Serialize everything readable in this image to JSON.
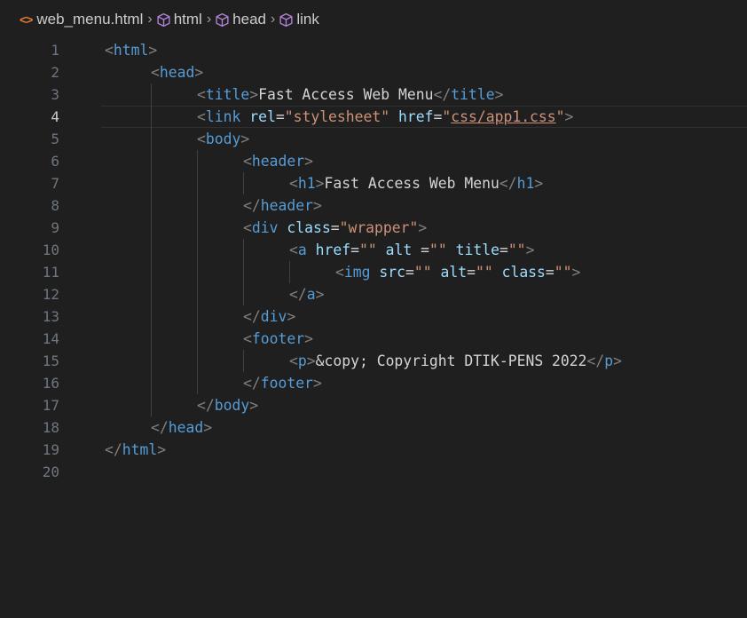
{
  "breadcrumb": {
    "file": "web_menu.html",
    "items": [
      "html",
      "head",
      "link"
    ]
  },
  "editor": {
    "current_line": 4,
    "lines": [
      {
        "n": "1",
        "indent": 0,
        "tokens": [
          [
            "t",
            "<"
          ],
          [
            "tag",
            "html"
          ],
          [
            "t",
            ">"
          ]
        ]
      },
      {
        "n": "2",
        "indent": 1,
        "tokens": [
          [
            "t",
            "<"
          ],
          [
            "tag",
            "head"
          ],
          [
            "t",
            ">"
          ]
        ]
      },
      {
        "n": "3",
        "indent": 2,
        "tokens": [
          [
            "t",
            "<"
          ],
          [
            "tag",
            "title"
          ],
          [
            "t",
            ">"
          ],
          [
            "txt",
            "Fast Access Web Menu"
          ],
          [
            "t",
            "</"
          ],
          [
            "tag",
            "title"
          ],
          [
            "t",
            ">"
          ]
        ]
      },
      {
        "n": "4",
        "indent": 2,
        "tokens": [
          [
            "t",
            "<"
          ],
          [
            "tag",
            "link"
          ],
          [
            "txt",
            " "
          ],
          [
            "attr",
            "rel"
          ],
          [
            "txt",
            "="
          ],
          [
            "str",
            "\"stylesheet\""
          ],
          [
            "txt",
            " "
          ],
          [
            "attr",
            "href"
          ],
          [
            "txt",
            "="
          ],
          [
            "str",
            "\""
          ],
          [
            "link",
            "css/app1.css"
          ],
          [
            "str",
            "\""
          ],
          [
            "t",
            ">"
          ]
        ]
      },
      {
        "n": "5",
        "indent": 2,
        "tokens": [
          [
            "t",
            "<"
          ],
          [
            "tag",
            "body"
          ],
          [
            "t",
            ">"
          ]
        ]
      },
      {
        "n": "6",
        "indent": 3,
        "tokens": [
          [
            "t",
            "<"
          ],
          [
            "tag",
            "header"
          ],
          [
            "t",
            ">"
          ]
        ]
      },
      {
        "n": "7",
        "indent": 4,
        "tokens": [
          [
            "t",
            "<"
          ],
          [
            "tag",
            "h1"
          ],
          [
            "t",
            ">"
          ],
          [
            "txt",
            "Fast Access Web Menu"
          ],
          [
            "t",
            "</"
          ],
          [
            "tag",
            "h1"
          ],
          [
            "t",
            ">"
          ]
        ]
      },
      {
        "n": "8",
        "indent": 3,
        "tokens": [
          [
            "t",
            "</"
          ],
          [
            "tag",
            "header"
          ],
          [
            "t",
            ">"
          ]
        ]
      },
      {
        "n": "9",
        "indent": 3,
        "tokens": [
          [
            "t",
            "<"
          ],
          [
            "tag",
            "div"
          ],
          [
            "txt",
            " "
          ],
          [
            "attr",
            "class"
          ],
          [
            "txt",
            "="
          ],
          [
            "str",
            "\"wrapper\""
          ],
          [
            "t",
            ">"
          ]
        ]
      },
      {
        "n": "10",
        "indent": 4,
        "tokens": [
          [
            "t",
            "<"
          ],
          [
            "tag",
            "a"
          ],
          [
            "txt",
            " "
          ],
          [
            "attr",
            "href"
          ],
          [
            "txt",
            "="
          ],
          [
            "str",
            "\"\""
          ],
          [
            "txt",
            " "
          ],
          [
            "attr",
            "alt"
          ],
          [
            "txt",
            " ="
          ],
          [
            "str",
            "\"\""
          ],
          [
            "txt",
            " "
          ],
          [
            "attr",
            "title"
          ],
          [
            "txt",
            "="
          ],
          [
            "str",
            "\"\""
          ],
          [
            "t",
            ">"
          ]
        ]
      },
      {
        "n": "11",
        "indent": 5,
        "tokens": [
          [
            "t",
            "<"
          ],
          [
            "tag",
            "img"
          ],
          [
            "txt",
            " "
          ],
          [
            "attr",
            "src"
          ],
          [
            "txt",
            "="
          ],
          [
            "str",
            "\"\""
          ],
          [
            "txt",
            " "
          ],
          [
            "attr",
            "alt"
          ],
          [
            "txt",
            "="
          ],
          [
            "str",
            "\"\""
          ],
          [
            "txt",
            " "
          ],
          [
            "attr",
            "class"
          ],
          [
            "txt",
            "="
          ],
          [
            "str",
            "\"\""
          ],
          [
            "t",
            ">"
          ]
        ]
      },
      {
        "n": "12",
        "indent": 4,
        "tokens": [
          [
            "t",
            "</"
          ],
          [
            "tag",
            "a"
          ],
          [
            "t",
            ">"
          ]
        ]
      },
      {
        "n": "13",
        "indent": 3,
        "tokens": [
          [
            "t",
            "</"
          ],
          [
            "tag",
            "div"
          ],
          [
            "t",
            ">"
          ]
        ]
      },
      {
        "n": "14",
        "indent": 3,
        "tokens": [
          [
            "t",
            "<"
          ],
          [
            "tag",
            "footer"
          ],
          [
            "t",
            ">"
          ]
        ]
      },
      {
        "n": "15",
        "indent": 4,
        "tokens": [
          [
            "t",
            "<"
          ],
          [
            "tag",
            "p"
          ],
          [
            "t",
            ">"
          ],
          [
            "txt",
            "&copy; Copyright DTIK-PENS 2022"
          ],
          [
            "t",
            "</"
          ],
          [
            "tag",
            "p"
          ],
          [
            "t",
            ">"
          ]
        ]
      },
      {
        "n": "16",
        "indent": 3,
        "tokens": [
          [
            "t",
            "</"
          ],
          [
            "tag",
            "footer"
          ],
          [
            "t",
            ">"
          ]
        ]
      },
      {
        "n": "17",
        "indent": 2,
        "tokens": [
          [
            "t",
            "</"
          ],
          [
            "tag",
            "body"
          ],
          [
            "t",
            ">"
          ]
        ]
      },
      {
        "n": "18",
        "indent": 1,
        "tokens": [
          [
            "t",
            "</"
          ],
          [
            "tag",
            "head"
          ],
          [
            "t",
            ">"
          ]
        ]
      },
      {
        "n": "19",
        "indent": 0,
        "tokens": [
          [
            "t",
            "</"
          ],
          [
            "tag",
            "html"
          ],
          [
            "t",
            ">"
          ]
        ]
      },
      {
        "n": "20",
        "indent": 0,
        "tokens": []
      }
    ]
  },
  "colors": {
    "background": "#1f1f1f",
    "tag": "#569cd6",
    "attribute": "#9cdcfe",
    "string": "#ce9178",
    "punctuation": "#808080",
    "text": "#d4d4d4",
    "line_number": "#6e7681"
  }
}
